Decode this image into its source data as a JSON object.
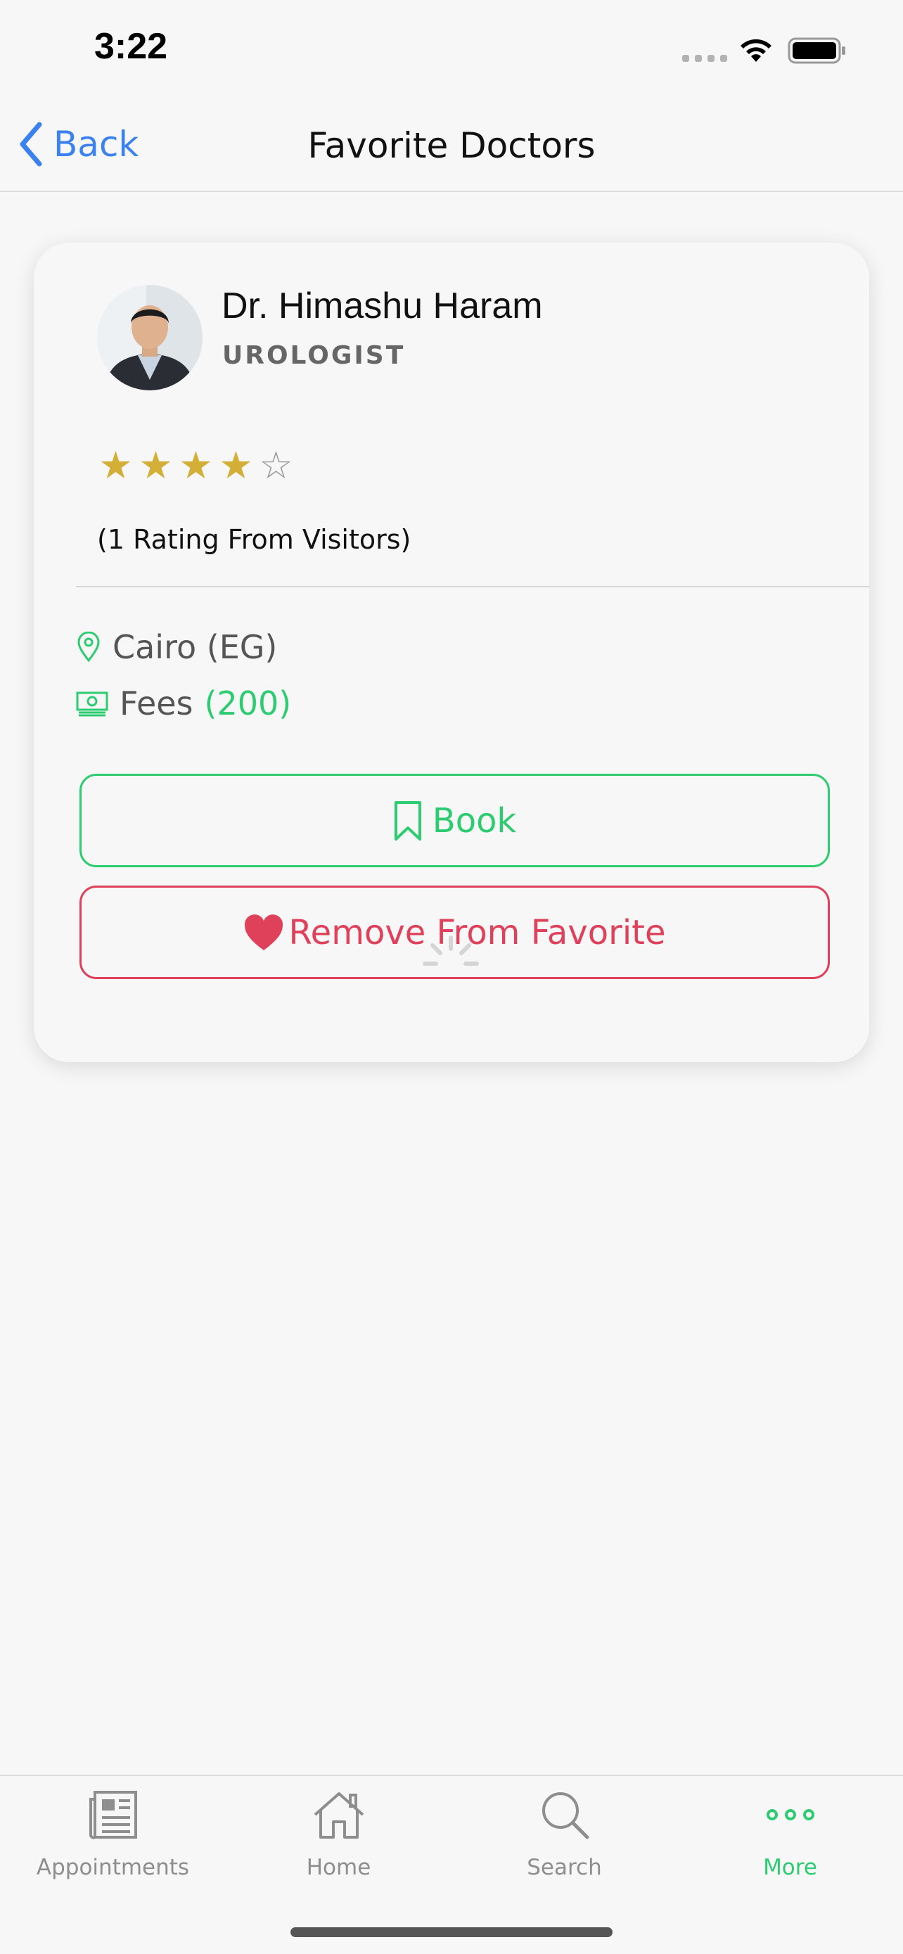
{
  "status_bar": {
    "time": "3:22"
  },
  "nav": {
    "back_label": "Back",
    "title": "Favorite Doctors"
  },
  "doctor": {
    "name": "Dr. Himashu Haram",
    "specialty": "UROLOGIST",
    "rating": 4,
    "rating_max": 5,
    "rating_text": "(1 Rating From Visitors)",
    "location": "Cairo (EG)",
    "fees_label": "Fees",
    "fees_amount": "(200)"
  },
  "actions": {
    "book_label": "Book",
    "remove_label": "Remove From Favorite"
  },
  "tabs": [
    {
      "label": "Appointments",
      "icon": "newspaper-icon",
      "active": false
    },
    {
      "label": "Home",
      "icon": "home-icon",
      "active": false
    },
    {
      "label": "Search",
      "icon": "search-icon",
      "active": false
    },
    {
      "label": "More",
      "icon": "more-dots-icon",
      "active": true
    }
  ],
  "colors": {
    "accent": "#2ecc71",
    "danger": "#e0415a",
    "link": "#3b82f0",
    "star": "#d4af37"
  }
}
